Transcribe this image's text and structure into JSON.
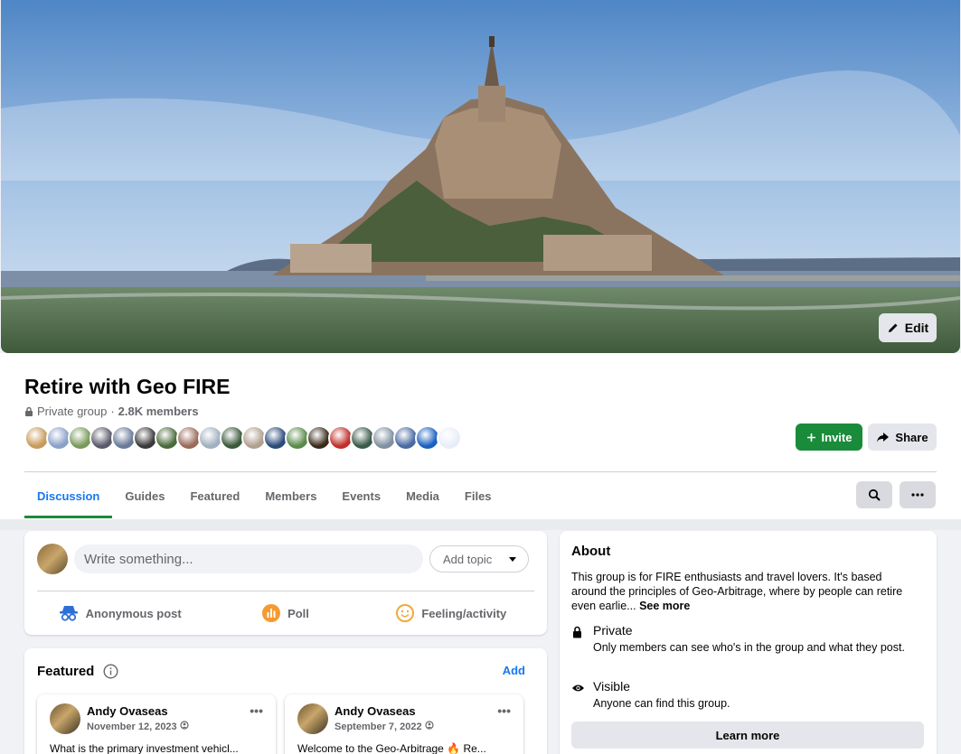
{
  "cover": {
    "edit_label": "Edit"
  },
  "group": {
    "title": "Retire with Geo FIRE",
    "privacy": "Private group",
    "separator": "·",
    "members": "2.8K members",
    "member_avatar_colors": [
      "#c89a5a",
      "#8aa0c8",
      "#7a9a5a",
      "#5a5a6a",
      "#6a7a9a",
      "#3a3a3a",
      "#4a6a3a",
      "#9a6a5a",
      "#a0b0c0",
      "#3a5a3a",
      "#b0a090",
      "#2a4a7a",
      "#5a8a4a",
      "#3a2a1a",
      "#c0302a",
      "#3a5a4a",
      "#8090a0",
      "#4a6aa0",
      "#1a60c0",
      "#e8eef8"
    ]
  },
  "actions": {
    "invite": "Invite",
    "share": "Share"
  },
  "tabs": [
    "Discussion",
    "Guides",
    "Featured",
    "Members",
    "Events",
    "Media",
    "Files"
  ],
  "composer": {
    "placeholder": "Write something...",
    "add_topic": "Add topic",
    "anonymous": "Anonymous post",
    "poll": "Poll",
    "feeling": "Feeling/activity"
  },
  "featured": {
    "title": "Featured",
    "add": "Add",
    "posts": [
      {
        "author": "Andy Ovaseas",
        "date": "November 12, 2023",
        "text": "What is the primary investment vehicl..."
      },
      {
        "author": "Andy Ovaseas",
        "date": "September 7, 2022",
        "text": "Welcome to the Geo-Arbitrage 🔥 Re..."
      }
    ]
  },
  "about": {
    "title": "About",
    "description": "This group is for FIRE enthusiasts and travel lovers. It's based around the principles of Geo-Arbitrage, where by people can retire even earlie...",
    "see_more": "See more",
    "private_label": "Private",
    "private_desc": "Only members can see who's in the group and what they post.",
    "visible_label": "Visible",
    "visible_desc": "Anyone can find this group.",
    "learn_more": "Learn more"
  }
}
